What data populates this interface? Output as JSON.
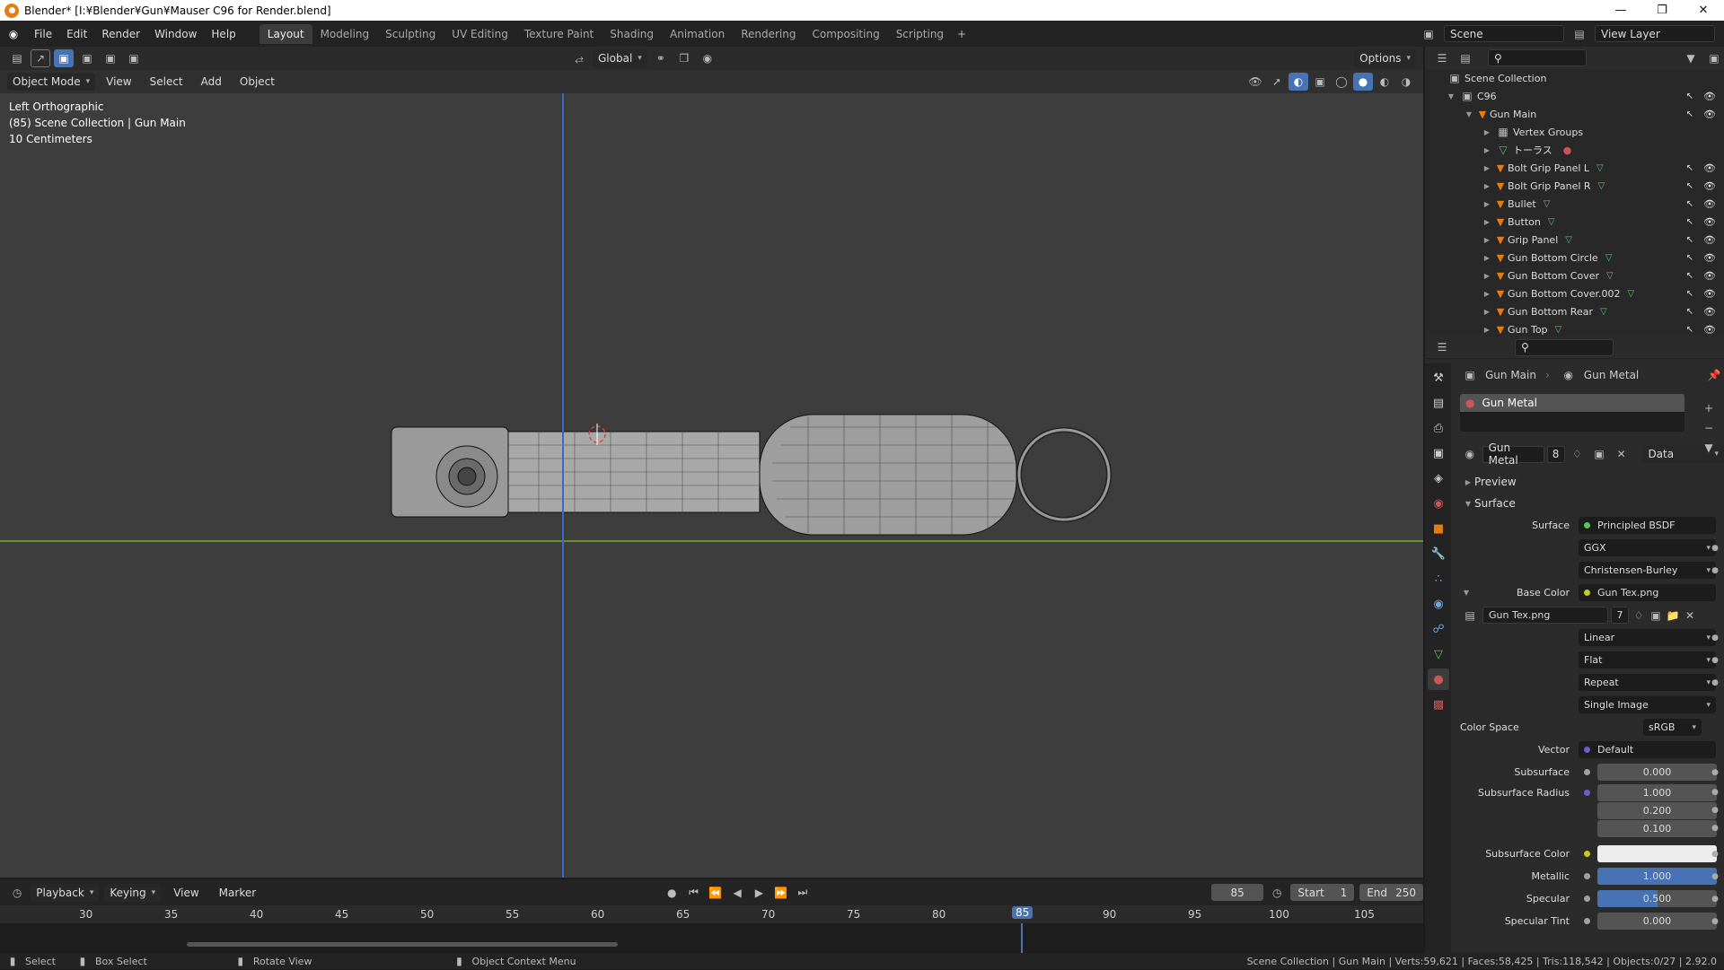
{
  "window": {
    "title": "Blender* [I:¥Blender¥Gun¥Mauser C96 for Render.blend]",
    "controls": [
      "—",
      "❐",
      "✕"
    ]
  },
  "menus": [
    "File",
    "Edit",
    "Render",
    "Window",
    "Help"
  ],
  "workspaces": [
    "Layout",
    "Modeling",
    "Sculpting",
    "UV Editing",
    "Texture Paint",
    "Shading",
    "Animation",
    "Rendering",
    "Compositing",
    "Scripting"
  ],
  "active_workspace": "Layout",
  "scene": {
    "name": "Scene",
    "view_layer": "View Layer"
  },
  "viewport": {
    "transform_orientation": "Global",
    "options_label": "Options",
    "mode": "Object Mode",
    "menus": [
      "View",
      "Select",
      "Add",
      "Object"
    ],
    "view_name": "Left Orthographic",
    "collection_info": "(85) Scene Collection | Gun Main",
    "scale": "10 Centimeters"
  },
  "outliner": {
    "root": "Scene Collection",
    "collection": "C96",
    "active_object": "Gun Main",
    "items": [
      "Vertex Groups",
      "トーラス",
      "Bolt Grip Panel L",
      "Bolt Grip Panel R",
      "Bullet",
      "Button",
      "Grip Panel",
      "Gun Bottom Circle",
      "Gun Bottom Cover",
      "Gun Bottom Cover.002",
      "Gun Bottom Rear",
      "Gun Top"
    ]
  },
  "properties": {
    "breadcrumb_object": "Gun Main",
    "breadcrumb_material": "Gun Metal",
    "slot": "Gun Metal",
    "material_name": "Gun Metal",
    "material_users": "8",
    "link": "Data",
    "sections": {
      "preview": "Preview",
      "surface": "Surface"
    },
    "surface_label": "Surface",
    "surface_shader": "Principled BSDF",
    "distribution": "GGX",
    "subsurface_method": "Christensen-Burley",
    "base_color_label": "Base Color",
    "base_color_texture": "Gun Tex.png",
    "image_name": "Gun Tex.png",
    "image_users": "7",
    "interpolation": "Linear",
    "projection": "Flat",
    "extension": "Repeat",
    "source": "Single Image",
    "color_space_label": "Color Space",
    "color_space": "sRGB",
    "vector_label": "Vector",
    "vector": "Default",
    "subsurface_label": "Subsurface",
    "subsurface": "0.000",
    "subsurface_radius_label": "Subsurface Radius",
    "subsurface_radius": [
      "1.000",
      "0.200",
      "0.100"
    ],
    "subsurface_color_label": "Subsurface Color",
    "metallic_label": "Metallic",
    "metallic": "1.000",
    "metallic_fraction": 1.0,
    "specular_label": "Specular",
    "specular": "0.500",
    "specular_fraction": 0.5,
    "specular_tint_label": "Specular Tint",
    "specular_tint": "0.000"
  },
  "timeline": {
    "menus": [
      "Playback",
      "Keying",
      "View",
      "Marker"
    ],
    "current_frame": "85",
    "start_label": "Start",
    "start": "1",
    "end_label": "End",
    "end": "250",
    "ticks": [
      "30",
      "35",
      "40",
      "45",
      "50",
      "55",
      "60",
      "65",
      "70",
      "75",
      "80",
      "85",
      "90",
      "95",
      "100",
      "105"
    ]
  },
  "status": {
    "select": "Select",
    "box_select": "Box Select",
    "rotate": "Rotate View",
    "context": "Object Context Menu",
    "stats": "Scene Collection | Gun Main | Verts:59,621 | Faces:58,425 | Tris:118,542 | Objects:0/27 | 2.92.0"
  },
  "colors": {
    "accent": "#4772b3",
    "x_axis": "#6c8f2c",
    "z_axis": "#3c6ac0",
    "mesh_icon": "#e87d0d",
    "active_tab": "#3c3c3c"
  }
}
